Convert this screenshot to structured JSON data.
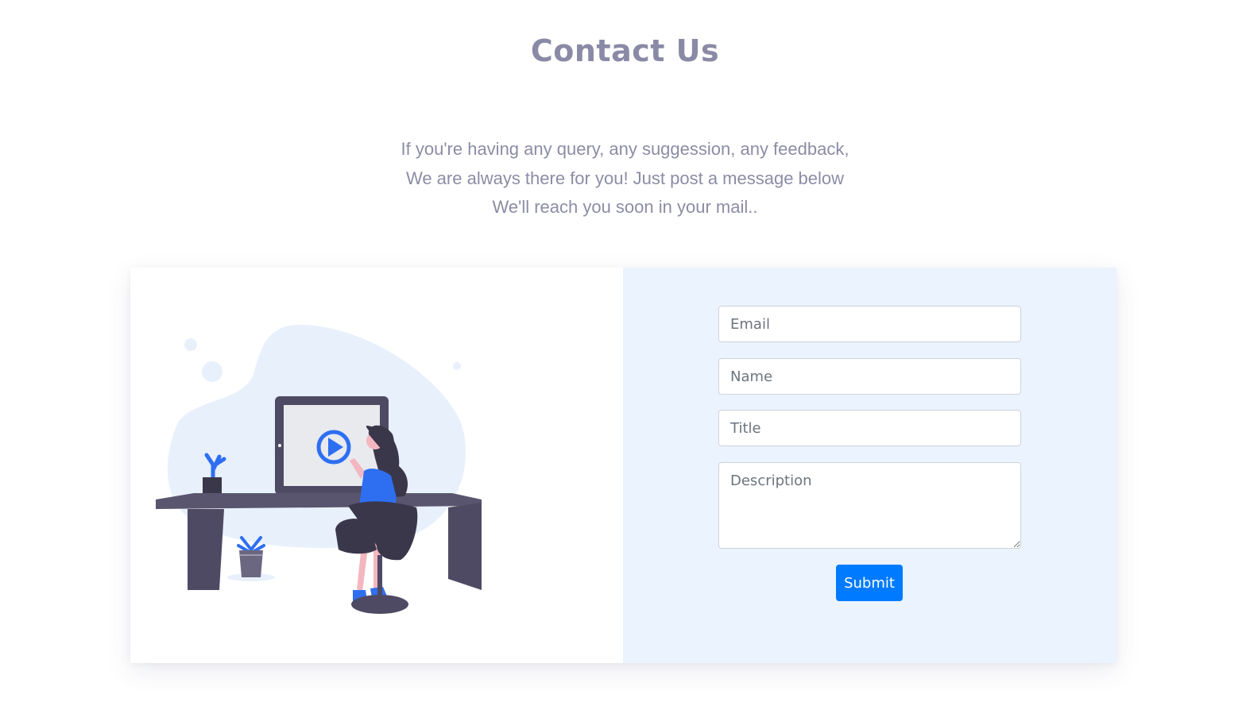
{
  "page": {
    "title": "Contact Us",
    "intro_lines": [
      "If you're having any query, any suggession, any feedback,",
      "We are always there for you! Just post a message below",
      "We'll reach you soon in your mail.."
    ]
  },
  "form": {
    "email_placeholder": "Email",
    "name_placeholder": "Name",
    "title_placeholder": "Title",
    "description_placeholder": "Description",
    "submit_label": "Submit"
  },
  "illustration": {
    "icon": "woman-at-desk-video-call-illustration",
    "play_icon": "play-circle-icon"
  },
  "colors": {
    "title": "#8a8aa6",
    "text": "#8c8ca6",
    "form_background": "#eaf3fe",
    "accent": "#007bff",
    "illustration_blue": "#2e6ff2",
    "illustration_dark": "#4f4a63",
    "blob": "#e8f0fc"
  }
}
